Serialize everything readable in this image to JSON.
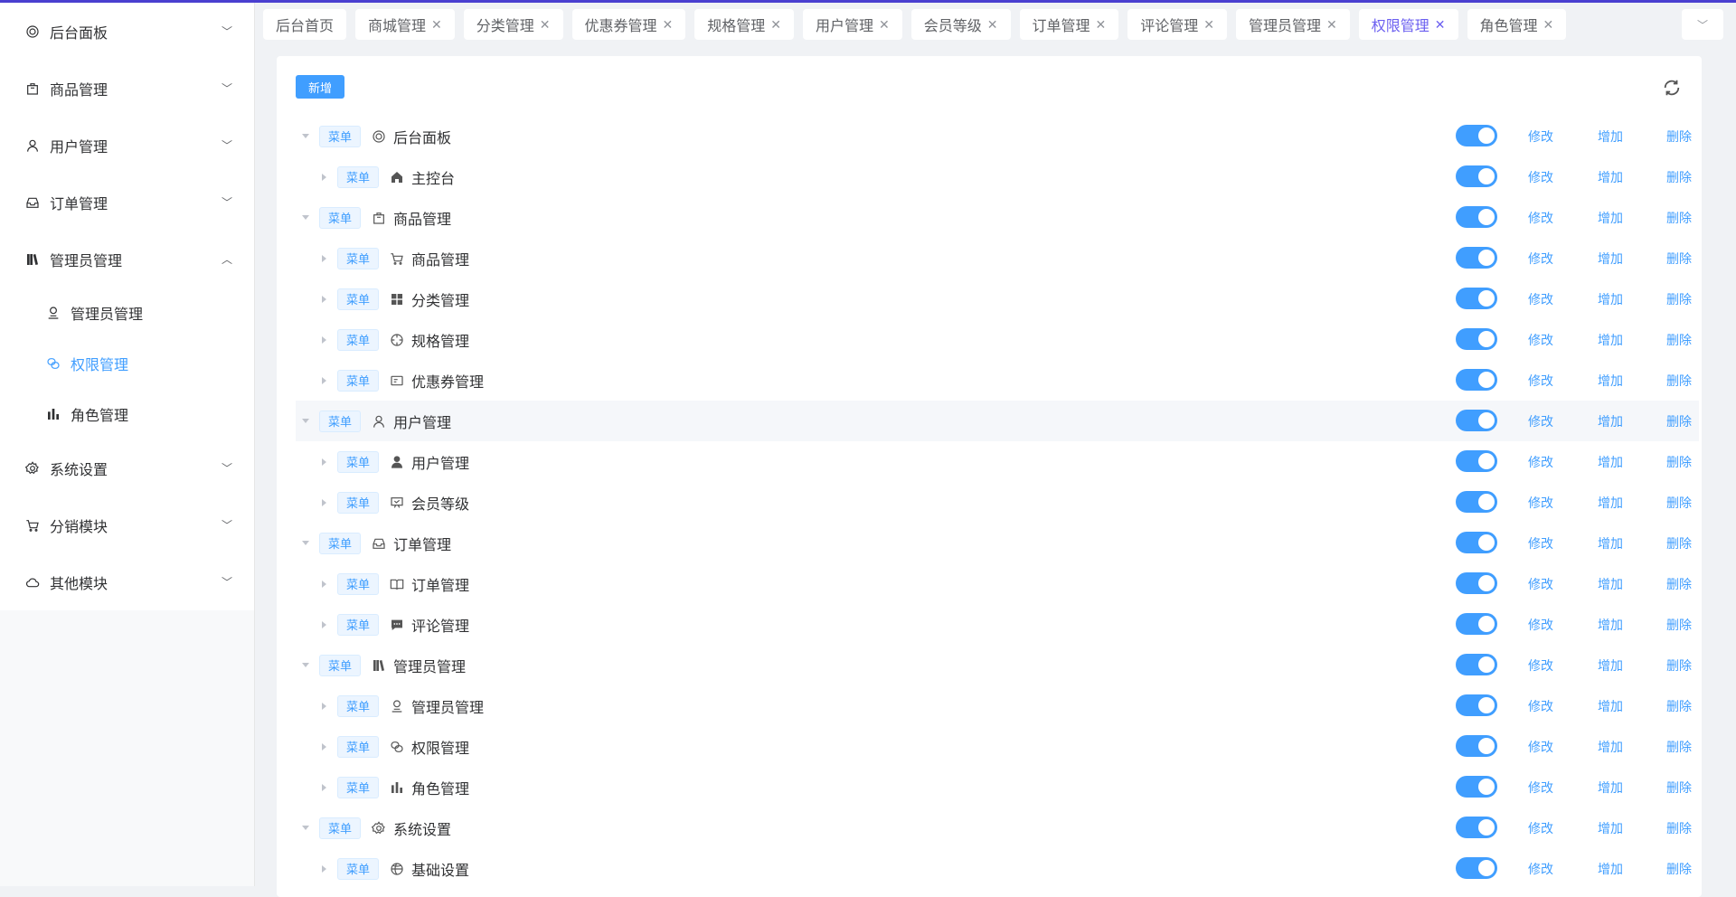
{
  "sidebar": {
    "items": [
      {
        "label": "后台面板",
        "icon": "dashboard-icon"
      },
      {
        "label": "商品管理",
        "icon": "shopping-bag-icon"
      },
      {
        "label": "用户管理",
        "icon": "user-icon"
      },
      {
        "label": "订单管理",
        "icon": "inbox-icon"
      },
      {
        "label": "管理员管理",
        "icon": "books-icon",
        "expanded": true,
        "children": [
          {
            "label": "管理员管理",
            "icon": "stamp-icon"
          },
          {
            "label": "权限管理",
            "icon": "link-icon",
            "active": true
          },
          {
            "label": "角色管理",
            "icon": "bar-chart-icon"
          }
        ]
      },
      {
        "label": "系统设置",
        "icon": "gear-icon"
      },
      {
        "label": "分销模块",
        "icon": "cart-icon"
      },
      {
        "label": "其他模块",
        "icon": "cloud-icon"
      }
    ]
  },
  "tabs": [
    {
      "label": "后台首页",
      "closable": false
    },
    {
      "label": "商城管理",
      "closable": true
    },
    {
      "label": "分类管理",
      "closable": true
    },
    {
      "label": "优惠券管理",
      "closable": true
    },
    {
      "label": "规格管理",
      "closable": true
    },
    {
      "label": "用户管理",
      "closable": true
    },
    {
      "label": "会员等级",
      "closable": true
    },
    {
      "label": "订单管理",
      "closable": true
    },
    {
      "label": "评论管理",
      "closable": true
    },
    {
      "label": "管理员管理",
      "closable": true
    },
    {
      "label": "权限管理",
      "closable": true,
      "active": true
    },
    {
      "label": "角色管理",
      "closable": true
    }
  ],
  "toolbar": {
    "add_label": "新增"
  },
  "actions": {
    "edit": "修改",
    "add": "增加",
    "delete": "删除"
  },
  "tree": [
    {
      "level": 0,
      "tag": "菜单",
      "icon": "dashboard-icon",
      "label": "后台面板",
      "enabled": true
    },
    {
      "level": 1,
      "tag": "菜单",
      "icon": "home-icon",
      "label": "主控台",
      "enabled": true
    },
    {
      "level": 0,
      "tag": "菜单",
      "icon": "shopping-bag-icon",
      "label": "商品管理",
      "enabled": true
    },
    {
      "level": 1,
      "tag": "菜单",
      "icon": "cart-icon",
      "label": "商品管理",
      "enabled": true
    },
    {
      "level": 1,
      "tag": "菜单",
      "icon": "grid-icon",
      "label": "分类管理",
      "enabled": true
    },
    {
      "level": 1,
      "tag": "菜单",
      "icon": "compass-icon",
      "label": "规格管理",
      "enabled": true
    },
    {
      "level": 1,
      "tag": "菜单",
      "icon": "ticket-icon",
      "label": "优惠券管理",
      "enabled": true
    },
    {
      "level": 0,
      "tag": "菜单",
      "icon": "user-icon",
      "label": "用户管理",
      "enabled": true,
      "highlight": true
    },
    {
      "level": 1,
      "tag": "菜单",
      "icon": "user-filled-icon",
      "label": "用户管理",
      "enabled": true
    },
    {
      "level": 1,
      "tag": "菜单",
      "icon": "presentation-icon",
      "label": "会员等级",
      "enabled": true
    },
    {
      "level": 0,
      "tag": "菜单",
      "icon": "inbox-icon",
      "label": "订单管理",
      "enabled": true
    },
    {
      "level": 1,
      "tag": "菜单",
      "icon": "book-icon",
      "label": "订单管理",
      "enabled": true
    },
    {
      "level": 1,
      "tag": "菜单",
      "icon": "chat-icon",
      "label": "评论管理",
      "enabled": true
    },
    {
      "level": 0,
      "tag": "菜单",
      "icon": "books-icon",
      "label": "管理员管理",
      "enabled": true
    },
    {
      "level": 1,
      "tag": "菜单",
      "icon": "stamp-icon",
      "label": "管理员管理",
      "enabled": true
    },
    {
      "level": 1,
      "tag": "菜单",
      "icon": "link-icon",
      "label": "权限管理",
      "enabled": true
    },
    {
      "level": 1,
      "tag": "菜单",
      "icon": "bar-chart-icon",
      "label": "角色管理",
      "enabled": true
    },
    {
      "level": 0,
      "tag": "菜单",
      "icon": "gear-icon",
      "label": "系统设置",
      "enabled": true
    },
    {
      "level": 1,
      "tag": "菜单",
      "icon": "basketball-icon",
      "label": "基础设置",
      "enabled": true
    }
  ],
  "colors": {
    "primary": "#409eff",
    "tab_active": "#6b5ff0",
    "top_line": "#4a3fd0"
  }
}
